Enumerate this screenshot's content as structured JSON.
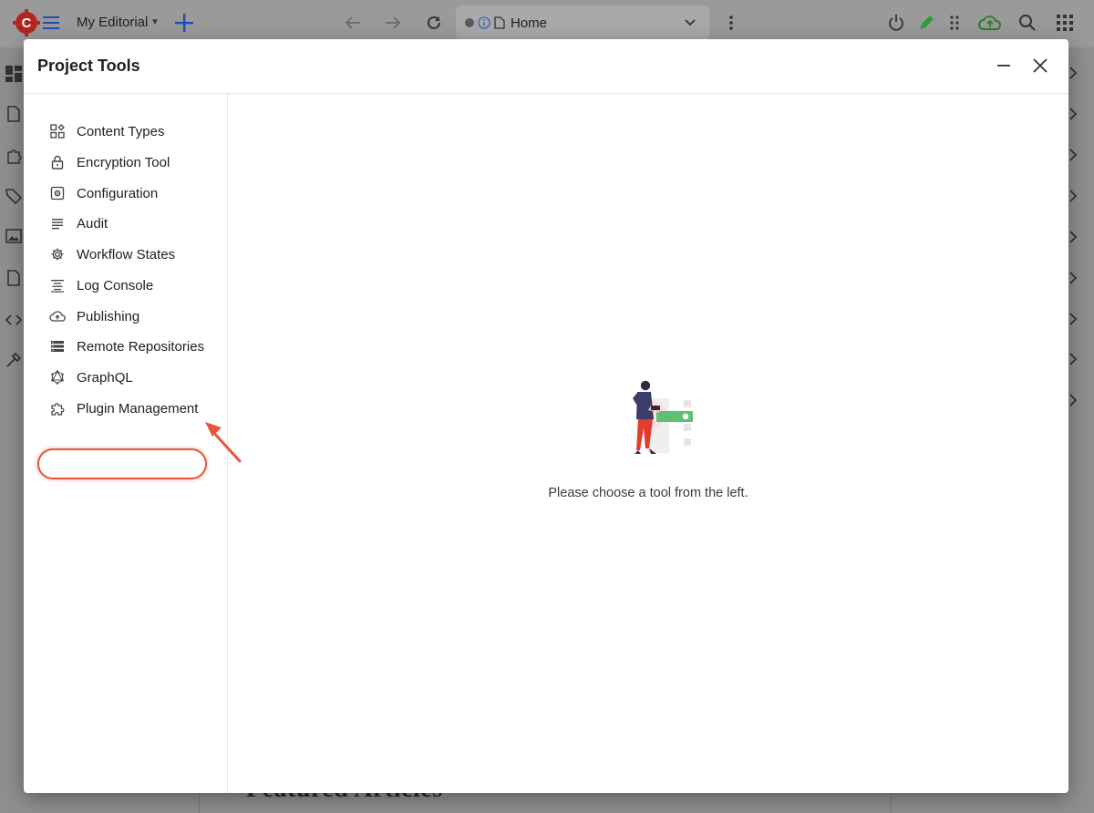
{
  "app": {
    "site_label": "My Editorial",
    "address_text": "Home"
  },
  "dialog": {
    "title": "Project Tools",
    "tools": [
      {
        "label": "Content Types",
        "icon": "content-types-icon"
      },
      {
        "label": "Encryption Tool",
        "icon": "lock-icon"
      },
      {
        "label": "Configuration",
        "icon": "configuration-icon"
      },
      {
        "label": "Audit",
        "icon": "audit-icon"
      },
      {
        "label": "Workflow States",
        "icon": "gear-icon"
      },
      {
        "label": "Log Console",
        "icon": "log-console-icon"
      },
      {
        "label": "Publishing",
        "icon": "cloud-upload-icon"
      },
      {
        "label": "Remote Repositories",
        "icon": "remote-repositories-icon"
      },
      {
        "label": "GraphQL",
        "icon": "graphql-icon"
      },
      {
        "label": "Plugin Management",
        "icon": "puzzle-icon"
      }
    ],
    "empty_message": "Please choose a tool from the left."
  },
  "background": {
    "heading_fragment": "Featured Articles"
  },
  "colors": {
    "highlight": "#e8553e",
    "accent_blue": "#1e4fb5",
    "brand_red": "#c62828",
    "cloud_green": "#2e7d32"
  }
}
